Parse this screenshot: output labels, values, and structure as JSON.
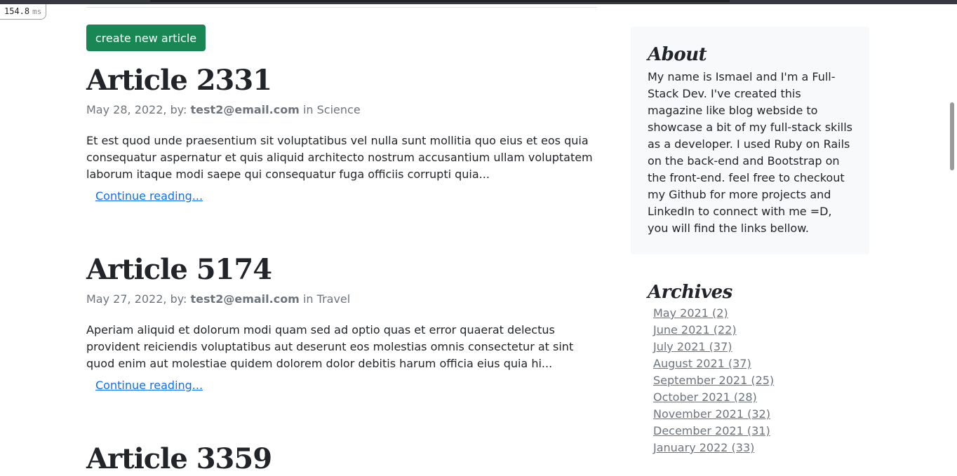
{
  "perf": {
    "value": "154.8",
    "unit": "ms"
  },
  "create_button": "create new article",
  "articles": [
    {
      "title": "Article 2331",
      "date": "May 28, 2022, by:",
      "author": "test2@email.com",
      "in": "in",
      "category": "Science",
      "excerpt": "Et est quod unde praesentium sit voluptatibus vel nulla sunt mollitia quo eius et eos quia consequatur aspernatur et quis aliquid architecto nostrum accusantium ullam voluptatem laborum itaque modi saepe qui consequatur fuga officiis corrupti quia...",
      "continue": "Continue reading..."
    },
    {
      "title": "Article 5174",
      "date": "May 27, 2022, by:",
      "author": "test2@email.com",
      "in": "in",
      "category": "Travel",
      "excerpt": "Aperiam aliquid et dolorum modi quam sed ad optio quas et error quaerat delectus provident reiciendis voluptatibus aut deserunt eos molestias omnis consectetur at sint quod enim aut molestiae quidem dolorem dolor debitis harum officia eius quia hi...",
      "continue": "Continue reading..."
    },
    {
      "title": "Article 3359"
    }
  ],
  "sidebar": {
    "about_title": "About",
    "about_text": "My name is Ismael and I'm a Full-Stack Dev. I've created this magazine like blog webside to showcase a bit of my full-stack skills as a developer. I used Ruby on Rails on the back-end and Bootstrap on the front-end. feel free to checkout my Github for more projects and LinkedIn to connect with me =D, you will find the links bellow.",
    "archives_title": "Archives",
    "archives": [
      "May 2021 (2)",
      "June 2021 (22)",
      "July 2021 (37)",
      "August 2021 (37)",
      "September 2021 (25)",
      "October 2021 (28)",
      "November 2021 (32)",
      "December 2021 (31)",
      "January 2022 (33)"
    ]
  },
  "colors": {
    "button_bg": "#198754",
    "link": "#0d6efd",
    "muted": "#6c757d",
    "about_bg": "#f8f9fa"
  }
}
